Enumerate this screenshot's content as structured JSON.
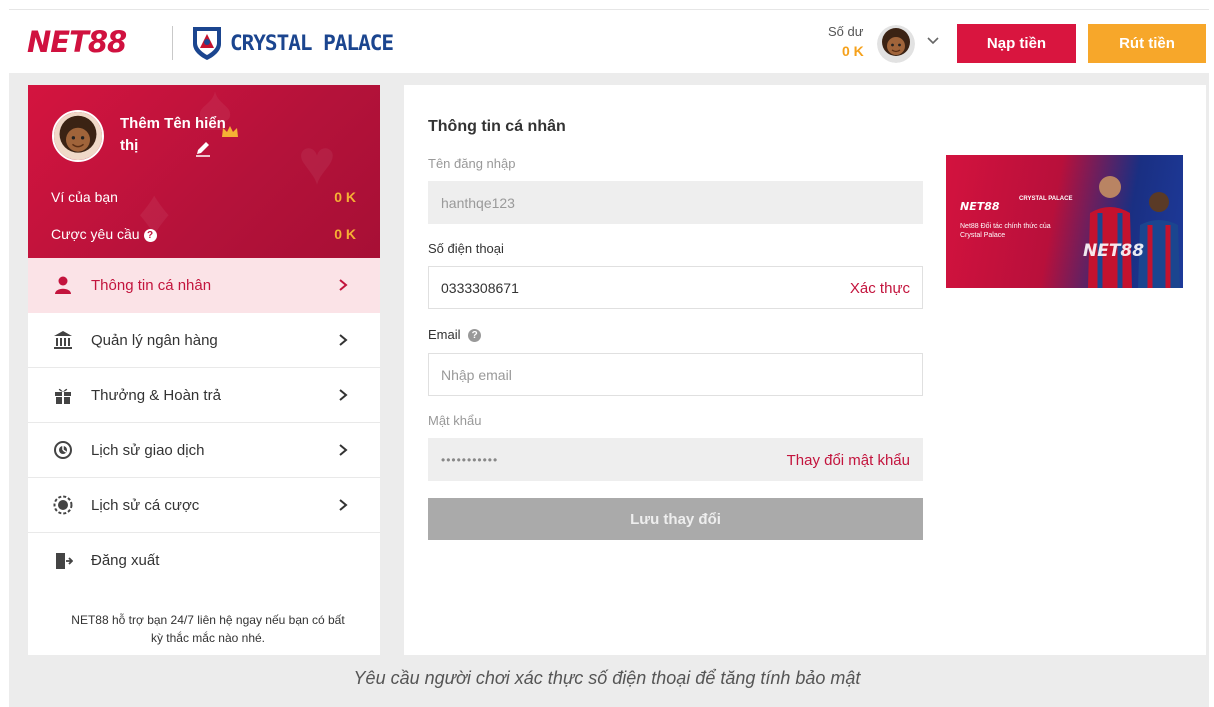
{
  "header": {
    "logo_text": "NET88",
    "partner_name": "CRYSTAL PALACE",
    "balance_label": "Số dư",
    "balance_value": "0 K",
    "deposit_label": "Nạp tiền",
    "withdraw_label": "Rút tiền"
  },
  "profile": {
    "display_name": "Thêm Tên hiển thị",
    "wallet_label": "Ví của bạn",
    "wallet_value": "0 K",
    "bet_required_label": "Cược yêu cầu",
    "bet_required_value": "0 K"
  },
  "menu": {
    "items": [
      {
        "label": "Thông tin cá nhân",
        "icon": "user-icon",
        "active": true
      },
      {
        "label": "Quản lý ngân hàng",
        "icon": "bank-icon",
        "active": false
      },
      {
        "label": "Thưởng & Hoàn trả",
        "icon": "gift-icon",
        "active": false
      },
      {
        "label": "Lịch sử giao dịch",
        "icon": "clock-icon",
        "active": false
      },
      {
        "label": "Lịch sử cá cược",
        "icon": "chip-icon",
        "active": false
      },
      {
        "label": "Đăng xuất",
        "icon": "logout-icon",
        "active": false
      }
    ],
    "support_text": "NET88 hỗ trợ bạn 24/7 liên hệ ngay nếu bạn có bất kỳ thắc mắc nào nhé."
  },
  "form": {
    "section_title": "Thông tin cá nhân",
    "username_label": "Tên đăng nhập",
    "username_value": "hanthqe123",
    "phone_label": "Số điện thoại",
    "phone_value": "0333308671",
    "phone_action": "Xác thực",
    "email_label": "Email",
    "email_placeholder": "Nhập email",
    "password_label": "Mật khẩu",
    "password_value": "•••••••••••",
    "password_action": "Thay đổi mật khẩu",
    "save_label": "Lưu thay đổi"
  },
  "banner": {
    "logo": "NET88",
    "club": "CRYSTAL PALACE",
    "text": "Net88 Đối tác chính thức của Crystal Palace",
    "brand": "NET88"
  },
  "caption": "Yêu cầu người chơi xác thực số điện thoại để tăng tính bảo mật",
  "colors": {
    "brand_red": "#d9153f",
    "brand_orange": "#f7a72a",
    "active_bg": "#fbe3e7",
    "palace_blue": "#1b458f"
  }
}
